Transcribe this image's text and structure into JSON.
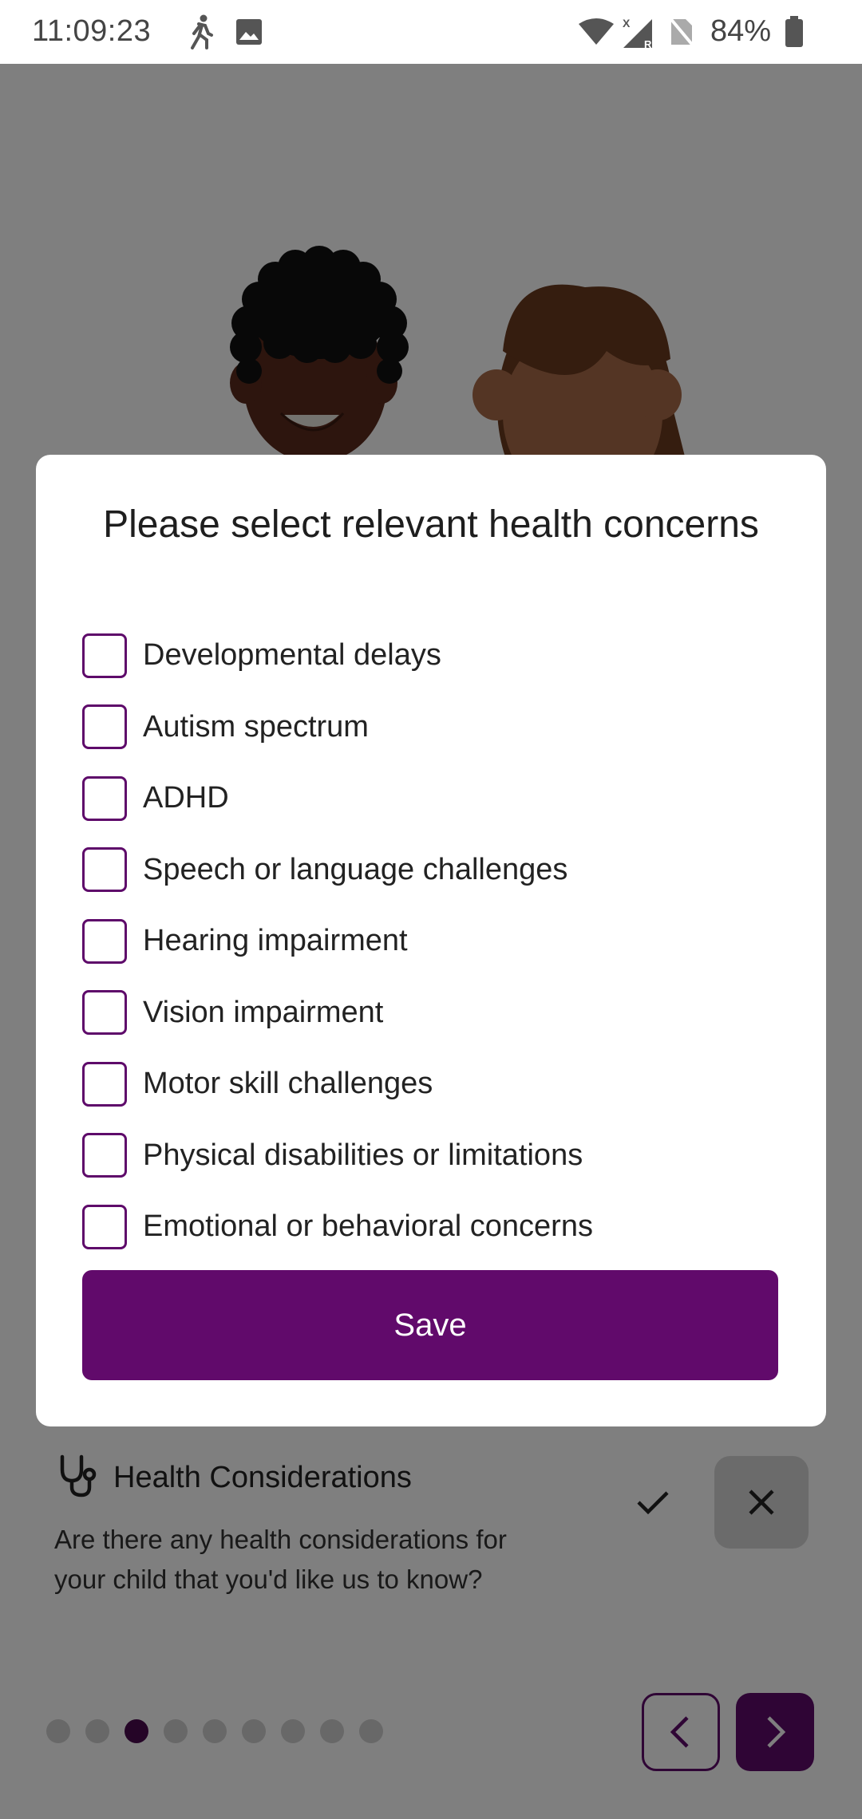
{
  "status_bar": {
    "time": "11:09:23",
    "battery": "84%",
    "icons": [
      "walking-icon",
      "image-icon",
      "wifi-icon",
      "signal-icon",
      "no-sim-icon",
      "battery-icon"
    ]
  },
  "dialog": {
    "title": "Please select relevant health concerns",
    "options": [
      {
        "label": "Developmental delays",
        "checked": false
      },
      {
        "label": "Autism spectrum",
        "checked": false
      },
      {
        "label": "ADHD",
        "checked": false
      },
      {
        "label": "Speech or language challenges",
        "checked": false
      },
      {
        "label": "Hearing impairment",
        "checked": false
      },
      {
        "label": "Vision impairment",
        "checked": false
      },
      {
        "label": "Motor skill challenges",
        "checked": false
      },
      {
        "label": "Physical disabilities or limitations",
        "checked": false
      },
      {
        "label": "Emotional or behavioral concerns",
        "checked": false
      }
    ],
    "save_label": "Save"
  },
  "section": {
    "title": "Health Considerations",
    "description": "Are there any health considerations for your child that you'd like us to know?"
  },
  "pager": {
    "total": 9,
    "current": 3
  },
  "colors": {
    "accent": "#610a6b",
    "scrim": "rgba(0,0,0,0.5)"
  }
}
